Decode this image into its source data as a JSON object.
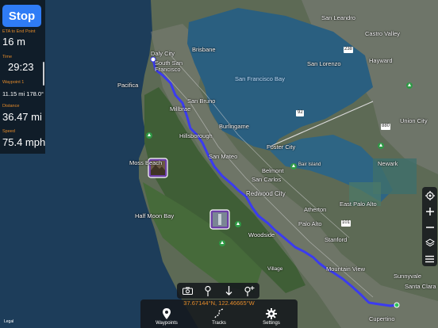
{
  "panel": {
    "stop_label": "Stop",
    "stats": [
      {
        "label": "ETA to End Point",
        "value": "16 m"
      },
      {
        "label": "Time",
        "value": "29:23"
      },
      {
        "label": "Waypoint 1",
        "value": "11.15 mi 178.0°"
      },
      {
        "label": "Distance",
        "value": "36.47 mi"
      },
      {
        "label": "Speed",
        "value": "75.4 mph"
      }
    ]
  },
  "map": {
    "labels": {
      "san_leandro": "San Leandro",
      "castro_valley": "Castro Valley",
      "daly_city": "Daly City",
      "brisbane": "Brisbane",
      "south_sf": "South San Francisco",
      "sf_bay": "San Francisco Bay",
      "hayward": "Hayward",
      "san_lorenzo": "San Lorenzo",
      "pacifica": "Pacifica",
      "millbrae": "Millbrae",
      "san_bruno": "San Bruno",
      "burlingame": "Burlingame",
      "hillsborough": "Hillsborough",
      "foster_city": "Foster City",
      "union_city": "Union City",
      "san_mateo": "San Mateo",
      "belmont": "Belmont",
      "bair_island": "Bair Island",
      "newark": "Newark",
      "moss_beach": "Moss Beach",
      "san_carlos": "San Carlos",
      "redwood_city": "Redwood City",
      "atherton": "Atherton",
      "east_palo_alto": "East Palo Alto",
      "half_moon_bay": "Half Moon Bay",
      "palo_alto": "Palo Alto",
      "woodside": "Woodside",
      "stanford": "Stanford",
      "mountain_view": "Mountain View",
      "sunnyvale": "Sunnyvale",
      "santa_clara": "Santa Clara",
      "cupertino": "Cupertino",
      "village": "Village",
      "hwy_238": "238",
      "hwy_92": "92",
      "hwy_880": "880",
      "hwy_101": "101"
    },
    "route_color": "#3b3bf0",
    "legal_text": "Legal"
  },
  "controls": {
    "right": [
      "locate-icon",
      "zoom-in-icon",
      "zoom-out-icon",
      "layers-icon",
      "menu-icon"
    ],
    "toolbar": [
      "camera-icon",
      "pin-icon",
      "arrow-down-icon",
      "add-pin-icon"
    ]
  },
  "bottom": {
    "coordinates": "37.67144°N, 122.46665°W",
    "tabs": [
      {
        "label": "Waypoints",
        "icon": "pin-icon"
      },
      {
        "label": "Tracks",
        "icon": "tracks-icon"
      },
      {
        "label": "Settings",
        "icon": "gear-icon"
      }
    ]
  },
  "colors": {
    "accent": "#2f7cf6",
    "orange": "#e38a2a",
    "panel": "#0e161e"
  }
}
